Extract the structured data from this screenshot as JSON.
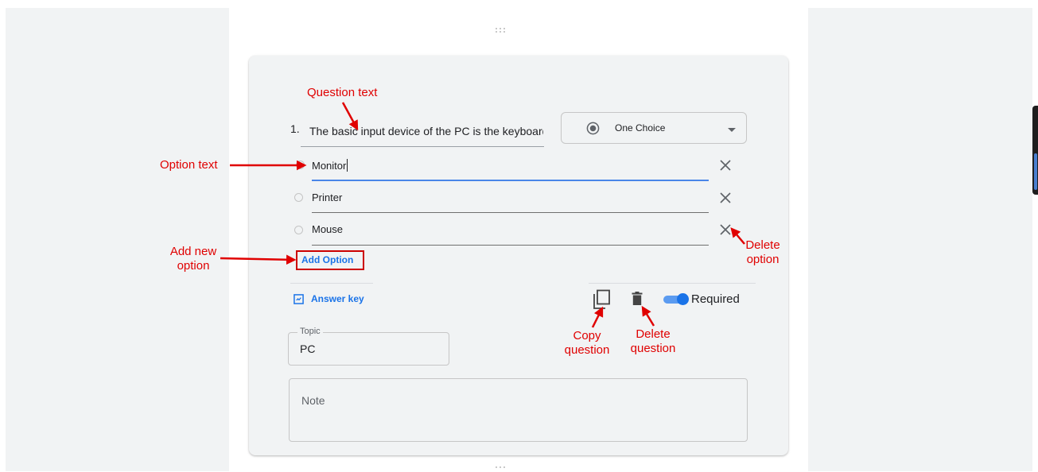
{
  "question": {
    "number": "1.",
    "text": "The basic input device of the PC is the keyboard",
    "type_label": "One Choice"
  },
  "options": [
    {
      "text": "Monitor"
    },
    {
      "text": "Printer"
    },
    {
      "text": "Mouse"
    }
  ],
  "add_option_label": "Add Option",
  "answer_key_label": "Answer key",
  "required_label": "Required",
  "required_on": true,
  "topic": {
    "label": "Topic",
    "value": "PC"
  },
  "note": {
    "placeholder": "Note"
  },
  "annotations": {
    "question_text": "Question text",
    "option_text": "Option text",
    "add_new_line1": "Add new",
    "add_new_line2": "option",
    "delete_option_line1": "Delete",
    "delete_option_line2": "option",
    "copy_question_line1": "Copy",
    "copy_question_line2": "question",
    "delete_question_line1": "Delete",
    "delete_question_line2": "question"
  },
  "colors": {
    "accent": "#1a73e8",
    "annotation": "#e00000",
    "card_background": "#f1f3f4"
  },
  "icons": [
    "drag-handle-icon",
    "radio-selected-icon",
    "dropdown-caret-icon",
    "close-icon",
    "answer-key-icon",
    "copy-icon",
    "trash-icon"
  ]
}
